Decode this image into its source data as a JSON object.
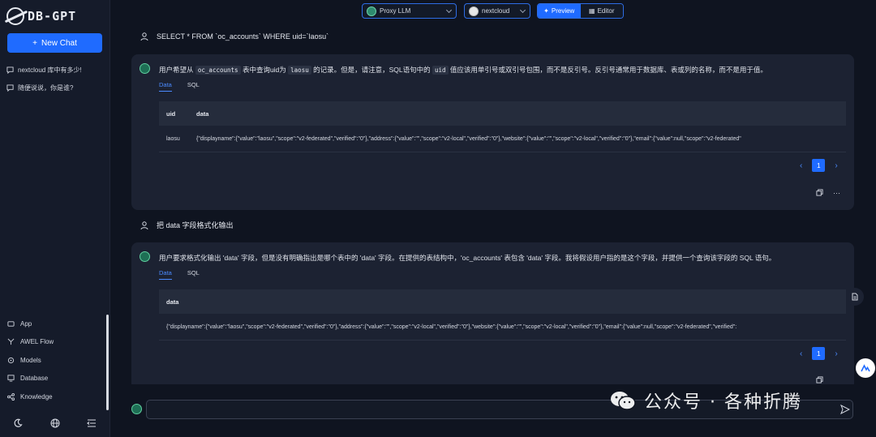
{
  "app": {
    "logo_text": "DB-GPT"
  },
  "sidebar": {
    "new_chat": "New Chat",
    "conversations": [
      "nextcloud 库中有多少!",
      "随便说说，你是谁?"
    ],
    "nav": [
      {
        "label": "App",
        "icon": "app-icon"
      },
      {
        "label": "AWEL Flow",
        "icon": "flow-icon"
      },
      {
        "label": "Models",
        "icon": "models-icon"
      },
      {
        "label": "Database",
        "icon": "database-icon"
      },
      {
        "label": "Knowledge",
        "icon": "knowledge-icon"
      }
    ]
  },
  "topbar": {
    "model": "Proxy LLM",
    "database": "nextcloud",
    "preview": "Preview",
    "editor": "Editor"
  },
  "messages": {
    "user1": "SELECT * FROM `oc_accounts` WHERE uid=`laosu`",
    "bot1": {
      "text_a": "用户希望从",
      "code_a": "oc_accounts",
      "text_b": "表中查询uid为",
      "code_b": "laosu",
      "text_c": "的记录。但是，请注意，SQL语句中的",
      "code_c": "uid",
      "text_d": "值应该用单引号或双引号包围，而不是反引号。反引号通常用于数据库、表或列的名称，而不是用于值。",
      "tabs": [
        "Data",
        "SQL"
      ],
      "columns": [
        "uid",
        "data"
      ],
      "row": {
        "uid": "laosu",
        "data": "{\"displayname\":{\"value\":\"laosu\",\"scope\":\"v2-federated\",\"verified\":\"0\"},\"address\":{\"value\":\"\",\"scope\":\"v2-local\",\"verified\":\"0\"},\"website\":{\"value\":\"\",\"scope\":\"v2-local\",\"verified\":\"0\"},\"email\":{\"value\":null,\"scope\":\"v2-federated\""
      },
      "page": "1"
    },
    "user2": "把 data 字段格式化输出",
    "bot2": {
      "text": "用户要求格式化输出 'data' 字段，但是没有明确指出是哪个表中的 'data' 字段。在提供的表结构中，'oc_accounts' 表包含 'data' 字段。我将假设用户指的是这个字段，并提供一个查询该字段的 SQL 语句。",
      "tabs": [
        "Data",
        "SQL"
      ],
      "columns": [
        "data"
      ],
      "row": {
        "data": "{\"displayname\":{\"value\":\"laosu\",\"scope\":\"v2-federated\",\"verified\":\"0\"},\"address\":{\"value\":\"\",\"scope\":\"v2-local\",\"verified\":\"0\"},\"website\":{\"value\":\"\",\"scope\":\"v2-local\",\"verified\":\"0\"},\"email\":{\"value\":null,\"scope\":\"v2-federated\",\"verified\":"
      },
      "page": "1"
    }
  },
  "card_actions": {
    "more": "···"
  },
  "pager_arrows": {
    "prev": "‹",
    "next": "›"
  },
  "watermark": "公众号 · 各种折腾"
}
